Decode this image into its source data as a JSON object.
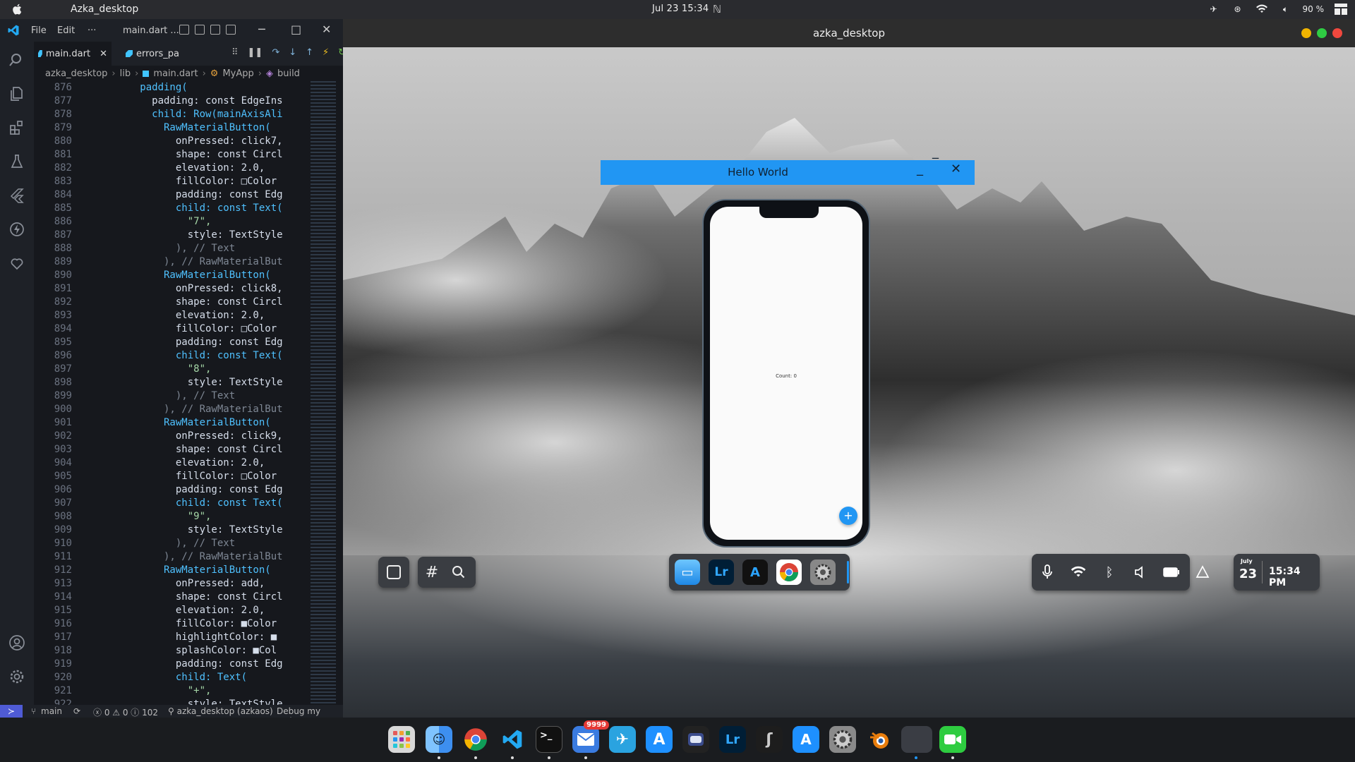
{
  "topbar": {
    "app_title": "Azka_desktop",
    "clock": "Jul 23  15:34",
    "battery": "90 %"
  },
  "vscode": {
    "menu": [
      "File",
      "Edit",
      "···"
    ],
    "window_title": "main.dart ...",
    "tabs": [
      {
        "label": "main.dart",
        "active": true
      },
      {
        "label": "errors_pa",
        "active": false
      }
    ],
    "breadcrumb": [
      "azka_desktop",
      "lib",
      "main.dart",
      "MyApp",
      "build"
    ],
    "status": {
      "branch": "main",
      "problems": "0 ⚠ 0 ⓘ 102",
      "project": "azka_desktop (azkaos)",
      "debug": "Debug my code +"
    },
    "line_numbers": [
      "876",
      "877",
      "878",
      "879",
      "880",
      "881",
      "882",
      "883",
      "884",
      "885",
      "886",
      "887",
      "888",
      "889",
      "890",
      "891",
      "892",
      "893",
      "894",
      "895",
      "896",
      "897",
      "898",
      "899",
      "900",
      "901",
      "902",
      "903",
      "904",
      "905",
      "906",
      "907",
      "908",
      "909",
      "910",
      "911",
      "912",
      "913",
      "914",
      "915",
      "916",
      "917",
      "918",
      "919",
      "920",
      "921",
      "922"
    ],
    "code_lines": [
      "          padding(",
      "            padding: const EdgeIns",
      "            child: Row(mainAxisAli",
      "              RawMaterialButton(",
      "                onPressed: click7,",
      "                shape: const Circl",
      "                elevation: 2.0,",
      "                fillColor: □Color",
      "                padding: const Edg",
      "                child: const Text(",
      "                  \"7\",",
      "                  style: TextStyle",
      "                ), // Text",
      "              ), // RawMaterialBut",
      "              RawMaterialButton(",
      "                onPressed: click8,",
      "                shape: const Circl",
      "                elevation: 2.0,",
      "                fillColor: □Color",
      "                padding: const Edg",
      "                child: const Text(",
      "                  \"8\",",
      "                  style: TextStyle",
      "                ), // Text",
      "              ), // RawMaterialBut",
      "              RawMaterialButton(",
      "                onPressed: click9,",
      "                shape: const Circl",
      "                elevation: 2.0,",
      "                fillColor: □Color",
      "                padding: const Edg",
      "                child: const Text(",
      "                  \"9\",",
      "                  style: TextStyle",
      "                ), // Text",
      "              ), // RawMaterialBut",
      "              RawMaterialButton(",
      "                onPressed: add,",
      "                shape: const Circl",
      "                elevation: 2.0,",
      "                fillColor: ■Color",
      "                highlightColor: ■",
      "                splashColor: ■Col",
      "                padding: const Edg",
      "                child: Text(",
      "                  \"+\",",
      "                  style: TextStyle"
    ]
  },
  "app_window": {
    "title": "azka_desktop",
    "hello_title": "Hello World",
    "count_text": "Count: 0",
    "fab_label": "+"
  },
  "widgets": {
    "date_month": "July",
    "date_day": "23",
    "time": "15:34 PM"
  },
  "dock": {
    "telegram_badge": "9999",
    "apps": [
      "launcher",
      "files",
      "chrome",
      "vscode",
      "terminal",
      "mail",
      "telegram",
      "appstore",
      "finder",
      "lightroom",
      "blender",
      "appstore-alt",
      "settings",
      "blender-alt",
      "folder",
      "facetime"
    ]
  },
  "colors": {
    "accent": "#2196f3",
    "vscode_blue": "#007acc",
    "topbar": "#2a2b2f"
  }
}
